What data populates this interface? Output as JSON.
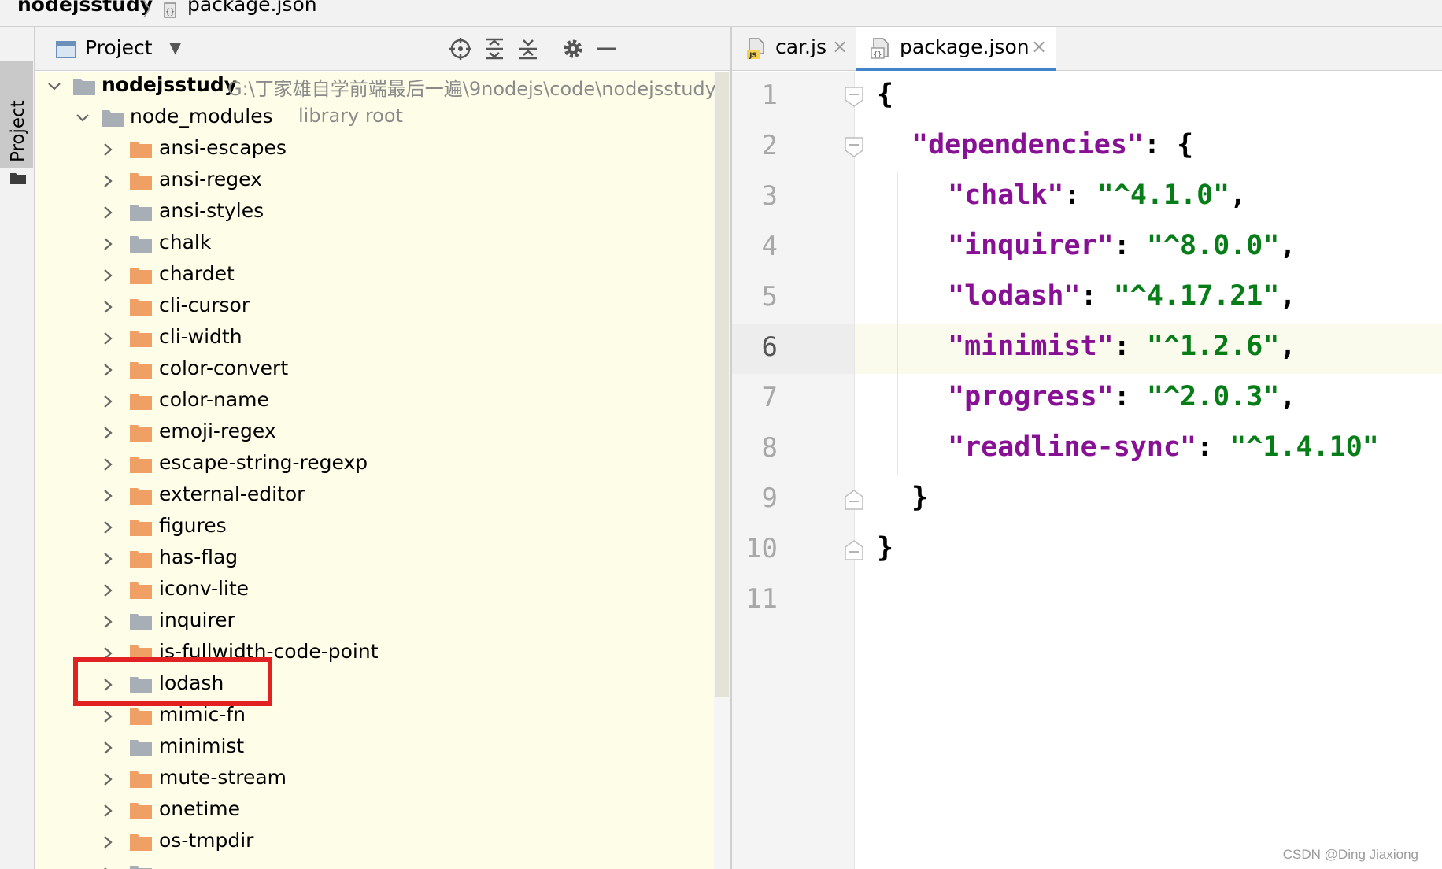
{
  "breadcrumb": {
    "root": "nodejsstudy",
    "separator": "〉",
    "file": "package.json"
  },
  "tool_stripe": {
    "label": "Project"
  },
  "project_panel": {
    "title": "Project",
    "toolbar_icons": [
      "locate-icon",
      "expand-all-icon",
      "collapse-all-icon",
      "gear-icon",
      "hide-icon"
    ],
    "root": {
      "name": "nodejsstudy",
      "path": "G:\\丁家雄自学前端最后一遍\\9nodejs\\code\\nodejsstudy"
    },
    "node_modules": {
      "name": "node_modules",
      "note": "library root"
    },
    "items": [
      {
        "name": "ansi-escapes",
        "color": "orange"
      },
      {
        "name": "ansi-regex",
        "color": "orange"
      },
      {
        "name": "ansi-styles",
        "color": "gray"
      },
      {
        "name": "chalk",
        "color": "gray"
      },
      {
        "name": "chardet",
        "color": "orange"
      },
      {
        "name": "cli-cursor",
        "color": "orange"
      },
      {
        "name": "cli-width",
        "color": "orange"
      },
      {
        "name": "color-convert",
        "color": "orange"
      },
      {
        "name": "color-name",
        "color": "orange"
      },
      {
        "name": "emoji-regex",
        "color": "orange"
      },
      {
        "name": "escape-string-regexp",
        "color": "orange"
      },
      {
        "name": "external-editor",
        "color": "orange"
      },
      {
        "name": "figures",
        "color": "orange"
      },
      {
        "name": "has-flag",
        "color": "orange"
      },
      {
        "name": "iconv-lite",
        "color": "orange"
      },
      {
        "name": "inquirer",
        "color": "gray"
      },
      {
        "name": "is-fullwidth-code-point",
        "color": "orange"
      },
      {
        "name": "lodash",
        "color": "gray"
      },
      {
        "name": "mimic-fn",
        "color": "orange"
      },
      {
        "name": "minimist",
        "color": "gray"
      },
      {
        "name": "mute-stream",
        "color": "orange"
      },
      {
        "name": "onetime",
        "color": "orange"
      },
      {
        "name": "os-tmpdir",
        "color": "orange"
      },
      {
        "name": "",
        "color": "gray"
      }
    ],
    "highlighted_item": "lodash"
  },
  "editor_tabs": [
    {
      "label": "car.js",
      "icon": "js-file-icon",
      "active": false,
      "close": "×"
    },
    {
      "label": "package.json",
      "icon": "json-file-icon",
      "active": true,
      "close": "×"
    }
  ],
  "editor": {
    "current_line": 6,
    "lines": [
      {
        "num": "1",
        "text": "{"
      },
      {
        "num": "2",
        "text": "\"dependencies\": {"
      },
      {
        "num": "3",
        "key": "\"chalk\"",
        "value": "\"^4.1.0\"",
        "comma": ","
      },
      {
        "num": "4",
        "key": "\"inquirer\"",
        "value": "\"^8.0.0\"",
        "comma": ","
      },
      {
        "num": "5",
        "key": "\"lodash\"",
        "value": "\"^4.17.21\"",
        "comma": ","
      },
      {
        "num": "6",
        "key": "\"minimist\"",
        "value": "\"^1.2.6\"",
        "comma": ","
      },
      {
        "num": "7",
        "key": "\"progress\"",
        "value": "\"^2.0.3\"",
        "comma": ","
      },
      {
        "num": "8",
        "key": "\"readline-sync\"",
        "value": "\"^1.4.10\"",
        "comma": ""
      },
      {
        "num": "9",
        "text": "}"
      },
      {
        "num": "10",
        "text": "}"
      },
      {
        "num": "11",
        "text": ""
      }
    ]
  },
  "watermark": "CSDN @Ding Jiaxiong",
  "colors": {
    "json_key": "#871094",
    "json_string": "#067d17",
    "folder_orange": "#f0a065",
    "folder_gray": "#a7aeb5",
    "tree_background": "#fdfde8",
    "annotation_box": "#e22222",
    "tab_underline": "#4083c9"
  }
}
